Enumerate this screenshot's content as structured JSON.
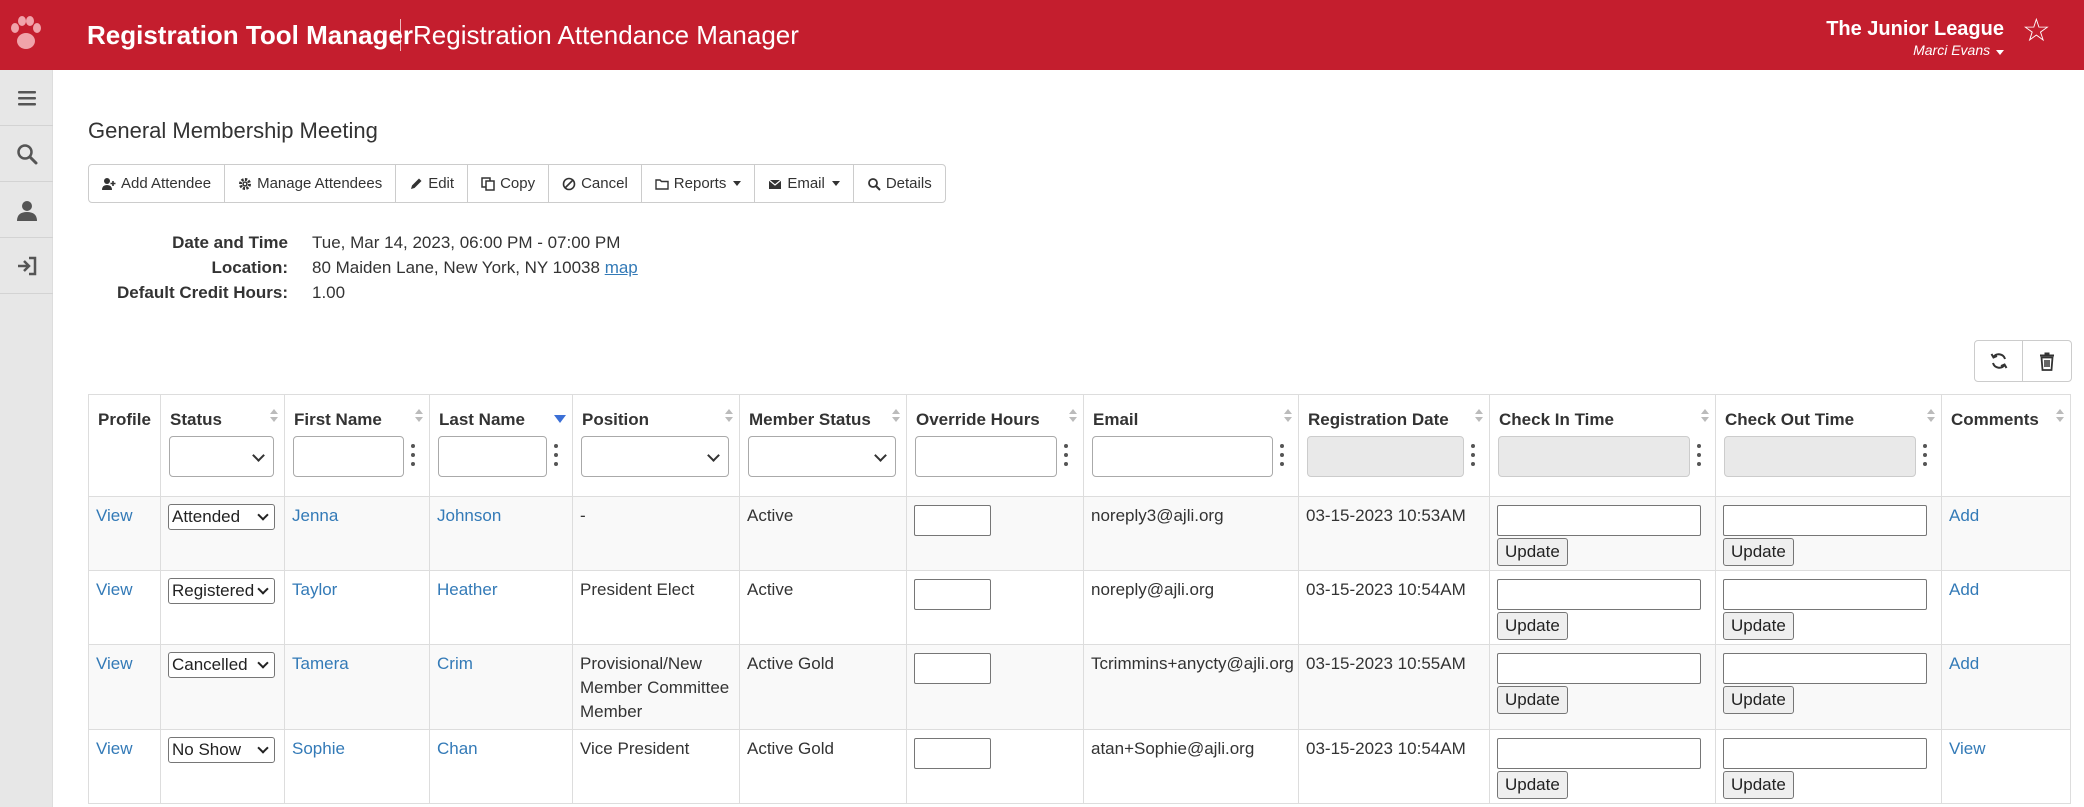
{
  "header": {
    "app_title": "Registration Tool Manager",
    "sub_title": "Registration Attendance Manager",
    "org_name": "The Junior League",
    "user_name": "Marci Evans",
    "accent_color": "#c41e2e"
  },
  "sidebar": {
    "items": [
      {
        "icon": "menu-icon"
      },
      {
        "icon": "search-icon"
      },
      {
        "icon": "user-icon"
      },
      {
        "icon": "logout-icon"
      }
    ]
  },
  "event": {
    "title": "General Membership Meeting",
    "labels": {
      "date": "Date and Time",
      "location": "Location:",
      "credit": "Default Credit Hours:"
    },
    "date_value": "Tue, Mar 14, 2023, 06:00 PM - 07:00 PM",
    "location_value": "80 Maiden Lane, New York, NY 10038",
    "map_link": "map",
    "credit_value": "1.00"
  },
  "toolbar": {
    "add_attendee": "Add Attendee",
    "manage_attendees": "Manage Attendees",
    "edit": "Edit",
    "copy": "Copy",
    "cancel": "Cancel",
    "reports": "Reports",
    "email": "Email",
    "details": "Details"
  },
  "table": {
    "columns": [
      "Profile",
      "Status",
      "First Name",
      "Last Name",
      "Position",
      "Member Status",
      "Override Hours",
      "Email",
      "Registration Date",
      "Check In Time",
      "Check Out Time",
      "Comments"
    ],
    "update_label": "Update",
    "rows": [
      {
        "profile": "View",
        "status": "Attended",
        "first": "Jenna",
        "last": "Johnson",
        "position": "-",
        "member_status": "Active",
        "email": "noreply3@ajli.org",
        "reg_date": "03-15-2023 10:53AM",
        "comments": "Add"
      },
      {
        "profile": "View",
        "status": "Registered",
        "first": "Taylor",
        "last": "Heather",
        "position": "President Elect",
        "member_status": "Active",
        "email": "noreply@ajli.org",
        "reg_date": "03-15-2023 10:54AM",
        "comments": "Add"
      },
      {
        "profile": "View",
        "status": "Cancelled",
        "first": "Tamera",
        "last": "Crim",
        "position": "Provisional/New Member Committee Member",
        "member_status": "Active Gold",
        "email": "Tcrimmins+anycty@ajli.org",
        "reg_date": "03-15-2023 10:55AM",
        "comments": "Add"
      },
      {
        "profile": "View",
        "status": "No Show",
        "first": "Sophie",
        "last": "Chan",
        "position": "Vice President",
        "member_status": "Active Gold",
        "email": "atan+Sophie@ajli.org",
        "reg_date": "03-15-2023 10:54AM",
        "comments": "View"
      }
    ]
  }
}
